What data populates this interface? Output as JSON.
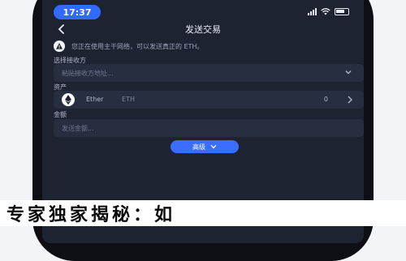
{
  "status_bar": {
    "time": "17:37"
  },
  "header": {
    "title": "发送交易"
  },
  "notice": {
    "text": "您正在使用主干网络，可以发送真正的 ETH。"
  },
  "network": {
    "label": "选择接收方",
    "placeholder": "粘贴接收方地址..."
  },
  "asset": {
    "label": "资产",
    "name": "Ether",
    "symbol": "ETH",
    "amount": "0"
  },
  "amount_field": {
    "label": "金额",
    "placeholder": "发送金额..."
  },
  "advanced_button": {
    "label": "高级"
  },
  "banner": {
    "text": "专家独家揭秘：如"
  }
}
